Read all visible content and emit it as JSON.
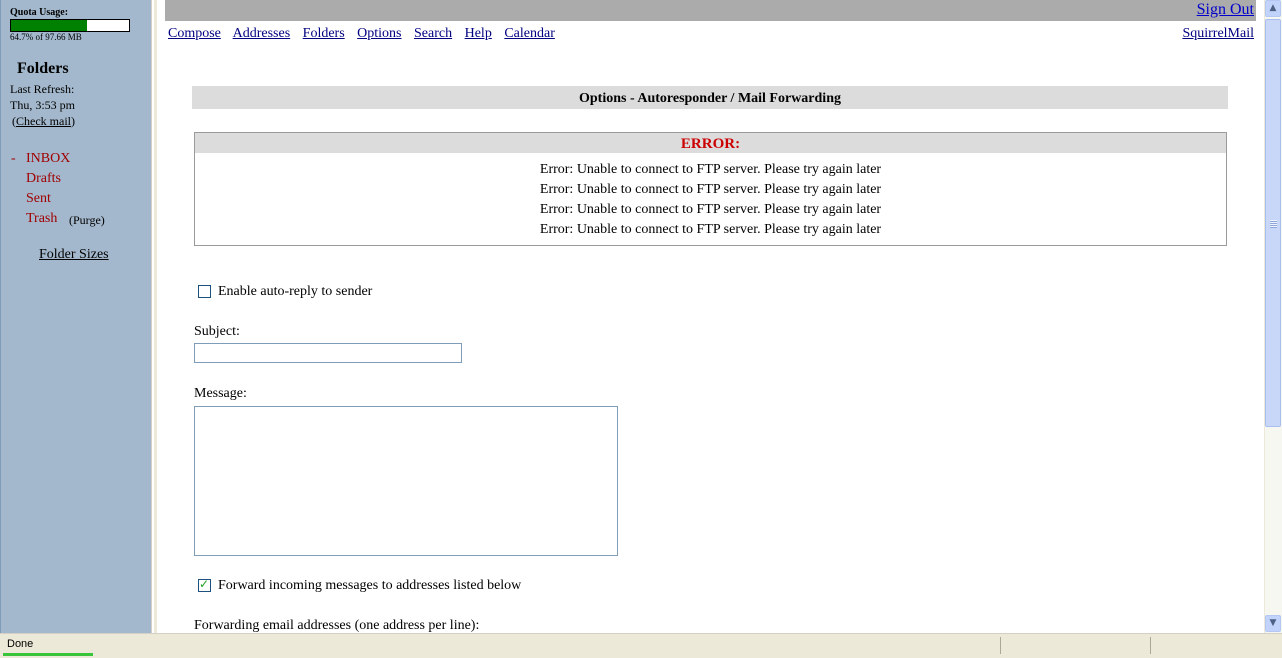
{
  "quota": {
    "label": "Quota Usage:",
    "percent": 64.7,
    "text": "64.7% of 97.66 MB",
    "bar_color": "#008000"
  },
  "sidebar": {
    "folders_title": "Folders",
    "last_refresh_label": "Last Refresh:",
    "last_refresh_time": "Thu, 3:53 pm",
    "check_mail_open": "(",
    "check_mail": "Check mail",
    "check_mail_close": ")",
    "inbox_toggle": "-",
    "folders": [
      "INBOX",
      "Drafts",
      "Sent",
      "Trash"
    ],
    "purge": "(Purge)",
    "folder_sizes": "Folder Sizes",
    "folder_color": "#a00000"
  },
  "header": {
    "sign_out": "Sign Out",
    "menu": [
      "Compose",
      "Addresses",
      "Folders",
      "Options",
      "Search",
      "Help",
      "Calendar"
    ],
    "brand": "SquirrelMail"
  },
  "main": {
    "title": "Options - Autoresponder / Mail Forwarding",
    "error_title": "ERROR:",
    "errors": [
      "Error: Unable to connect to FTP server. Please try again later",
      "Error: Unable to connect to FTP server. Please try again later",
      "Error: Unable to connect to FTP server. Please try again later",
      "Error: Unable to connect to FTP server. Please try again later"
    ],
    "autoreply_label": "Enable auto-reply to sender",
    "autoreply_checked": false,
    "subject_label": "Subject:",
    "subject_value": "",
    "message_label": "Message:",
    "message_value": "",
    "forward_label": "Forward incoming messages to addresses listed below",
    "forward_checked": true,
    "forwarding_label": "Forwarding email addresses (one address per line):"
  },
  "statusbar": {
    "text": "Done"
  }
}
